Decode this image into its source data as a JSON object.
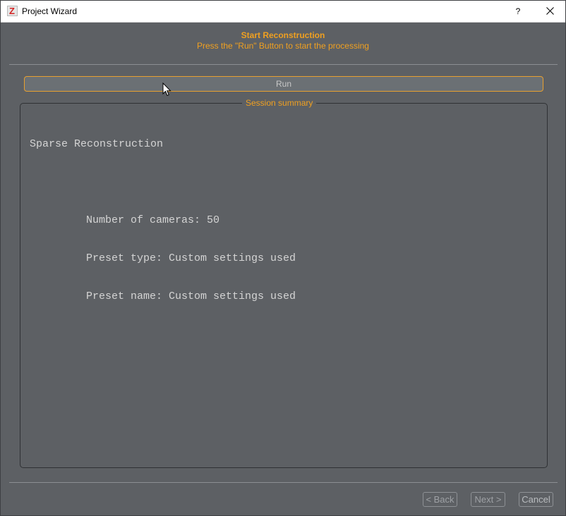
{
  "window": {
    "title": "Project Wizard",
    "icon_letter": "Z",
    "help_label": "?",
    "close_icon": "close-icon"
  },
  "header": {
    "title": "Start Reconstruction",
    "subtitle": "Press the \"Run\" Button to start the processing"
  },
  "run_button": {
    "label": "Run"
  },
  "session_summary": {
    "legend": "Session summary",
    "heading": "Sparse Reconstruction",
    "lines": [
      "Number of cameras: 50",
      "Preset type: Custom settings used",
      "Preset name: Custom settings used"
    ]
  },
  "footer": {
    "back_label": "< Back",
    "next_label": "Next >",
    "cancel_label": "Cancel"
  },
  "colors": {
    "accent": "#f0a020",
    "background": "#5d6064",
    "text": "#d4d4d4"
  }
}
